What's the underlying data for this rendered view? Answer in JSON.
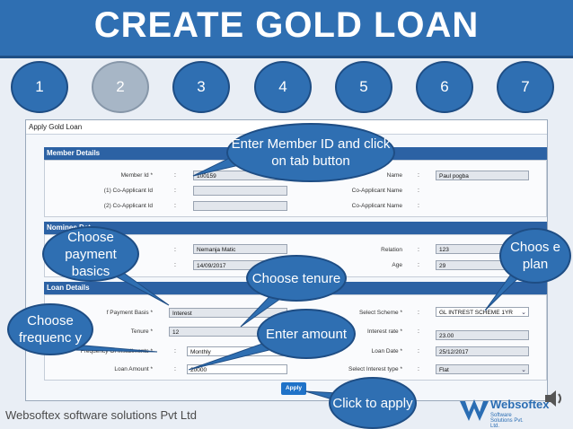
{
  "banner": {
    "title": "CREATE GOLD LOAN"
  },
  "steps": [
    {
      "label": "1",
      "active": false
    },
    {
      "label": "2",
      "active": true
    },
    {
      "label": "3",
      "active": false
    },
    {
      "label": "4",
      "active": false
    },
    {
      "label": "5",
      "active": false
    },
    {
      "label": "6",
      "active": false
    },
    {
      "label": "7",
      "active": false
    }
  ],
  "window": {
    "title": "Apply Gold Loan"
  },
  "member_details": {
    "title": "Member Details",
    "member_id_label": "Member Id *",
    "member_id_value": "100159",
    "name_label": "Name",
    "name_value": "Paul pogba",
    "co1_label": "(1) Co-Applicant Id",
    "co1_name_label": "Co-Applicant Name",
    "co2_label": "(2) Co-Applicant Id",
    "co2_name_label": "Co-Applicant Name"
  },
  "nominee_details": {
    "title": "Nominee Det",
    "name_value": "Nemanja Matic",
    "relation_label": "Relation",
    "relation_value": "123",
    "dob_value": "14/09/2017",
    "age_label": "Age",
    "age_value": "29"
  },
  "loan_details": {
    "title": "Loan Details",
    "payment_basis_label": "f Payment Basis *",
    "payment_basis_value": "Interest",
    "tenure_label": "Tenure *",
    "tenure_value": "12",
    "frequency_label": "Frequency Of Installments *",
    "frequency_value": "Monthly",
    "amount_label": "Loan Amount *",
    "amount_value": "20000",
    "scheme_label": "Select Scheme *",
    "scheme_value": "GL INTREST SCHEME 1YR",
    "rate_label": "Interest rate *",
    "rate_value": "23.00",
    "date_label": "Loan Date *",
    "date_value": "25/12/2017",
    "interest_type_label": "Select Interest type *",
    "interest_type_value": "Flat"
  },
  "apply_button": "Apply",
  "callouts": {
    "member_id": "Enter Member ID and click on tab button",
    "payment": "Choose payment basics",
    "tenure": "Choose tenure",
    "plan": "Choos e plan",
    "frequency": "Choose frequenc y",
    "amount": "Enter amount",
    "apply": "Click to apply"
  },
  "footer": {
    "company": "Websoftex software solutions Pvt Ltd"
  },
  "logo": {
    "name": "Websoftex",
    "tagline": "Software Solutions Pvt. Ltd."
  },
  "colors": {
    "brand_blue": "#2f6fb2",
    "section_blue": "#2c62a4",
    "apply_blue": "#1f72c8"
  }
}
